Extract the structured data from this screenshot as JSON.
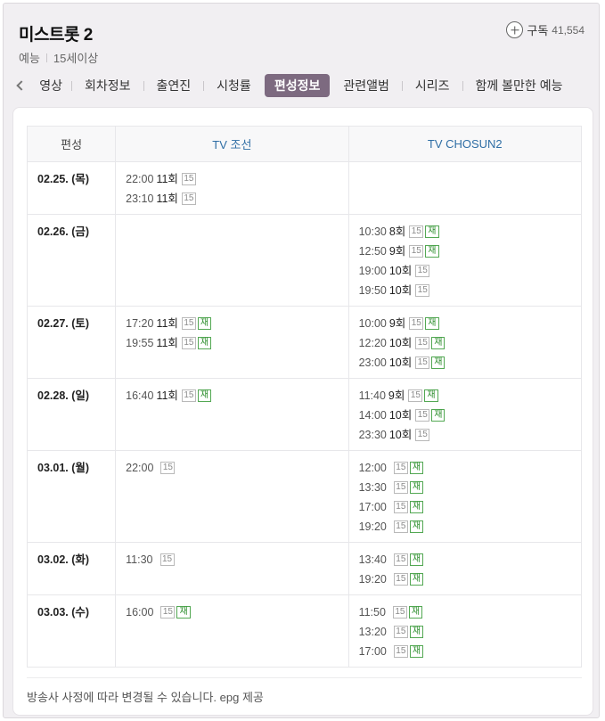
{
  "header": {
    "title": "미스트롯 2",
    "genre": "예능",
    "age_rating": "15세이상",
    "subscribe_label": "구독",
    "subscribe_count": "41,554"
  },
  "tabs": [
    {
      "label": "영상",
      "visible_text": "영상"
    },
    {
      "label": "회차정보"
    },
    {
      "label": "출연진"
    },
    {
      "label": "시청률"
    },
    {
      "label": "편성정보",
      "active": true
    },
    {
      "label": "관련앨범"
    },
    {
      "label": "시리즈"
    },
    {
      "label": "함께 볼만한 예능"
    }
  ],
  "schedule": {
    "columns": [
      "편성",
      "TV 조선",
      "TV CHOSUN2"
    ],
    "rows": [
      {
        "date": "02.25. (목)",
        "ch1": [
          {
            "time": "22:00",
            "ep": "11회",
            "rating": "15",
            "rerun": ""
          },
          {
            "time": "23:10",
            "ep": "11회",
            "rating": "15",
            "rerun": ""
          }
        ],
        "ch2": []
      },
      {
        "date": "02.26. (금)",
        "ch1": [],
        "ch2": [
          {
            "time": "10:30",
            "ep": "8회",
            "rating": "15",
            "rerun": "재"
          },
          {
            "time": "12:50",
            "ep": "9회",
            "rating": "15",
            "rerun": "재"
          },
          {
            "time": "19:00",
            "ep": "10회",
            "rating": "15",
            "rerun": ""
          },
          {
            "time": "19:50",
            "ep": "10회",
            "rating": "15",
            "rerun": ""
          }
        ]
      },
      {
        "date": "02.27. (토)",
        "ch1": [
          {
            "time": "17:20",
            "ep": "11회",
            "rating": "15",
            "rerun": "재"
          },
          {
            "time": "19:55",
            "ep": "11회",
            "rating": "15",
            "rerun": "재"
          }
        ],
        "ch2": [
          {
            "time": "10:00",
            "ep": "9회",
            "rating": "15",
            "rerun": "재"
          },
          {
            "time": "12:20",
            "ep": "10회",
            "rating": "15",
            "rerun": "재"
          },
          {
            "time": "23:00",
            "ep": "10회",
            "rating": "15",
            "rerun": "재"
          }
        ]
      },
      {
        "date": "02.28. (일)",
        "ch1": [
          {
            "time": "16:40",
            "ep": "11회",
            "rating": "15",
            "rerun": "재"
          }
        ],
        "ch2": [
          {
            "time": "11:40",
            "ep": "9회",
            "rating": "15",
            "rerun": "재"
          },
          {
            "time": "14:00",
            "ep": "10회",
            "rating": "15",
            "rerun": "재"
          },
          {
            "time": "23:30",
            "ep": "10회",
            "rating": "15",
            "rerun": ""
          }
        ]
      },
      {
        "date": "03.01. (월)",
        "ch1": [
          {
            "time": "22:00",
            "ep": "",
            "rating": "15",
            "rerun": ""
          }
        ],
        "ch2": [
          {
            "time": "12:00",
            "ep": "",
            "rating": "15",
            "rerun": "재"
          },
          {
            "time": "13:30",
            "ep": "",
            "rating": "15",
            "rerun": "재"
          },
          {
            "time": "17:00",
            "ep": "",
            "rating": "15",
            "rerun": "재"
          },
          {
            "time": "19:20",
            "ep": "",
            "rating": "15",
            "rerun": "재"
          }
        ]
      },
      {
        "date": "03.02. (화)",
        "ch1": [
          {
            "time": "11:30",
            "ep": "",
            "rating": "15",
            "rerun": ""
          }
        ],
        "ch2": [
          {
            "time": "13:40",
            "ep": "",
            "rating": "15",
            "rerun": "재"
          },
          {
            "time": "19:20",
            "ep": "",
            "rating": "15",
            "rerun": "재"
          }
        ]
      },
      {
        "date": "03.03. (수)",
        "ch1": [
          {
            "time": "16:00",
            "ep": "",
            "rating": "15",
            "rerun": "재"
          }
        ],
        "ch2": [
          {
            "time": "11:50",
            "ep": "",
            "rating": "15",
            "rerun": "재"
          },
          {
            "time": "13:20",
            "ep": "",
            "rating": "15",
            "rerun": "재"
          },
          {
            "time": "17:00",
            "ep": "",
            "rating": "15",
            "rerun": "재"
          }
        ]
      }
    ]
  },
  "footer_note": "방송사 사정에 따라 변경될 수 있습니다. epg 제공",
  "colors": {
    "active_tab": "#7d6a80",
    "channel_header": "#2f6ea5",
    "rerun": "#2e8f2e"
  }
}
